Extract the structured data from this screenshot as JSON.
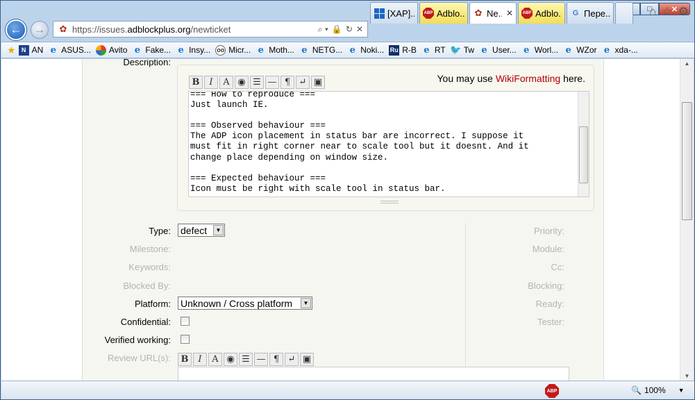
{
  "window": {
    "minimize": "–",
    "maximize": "□",
    "close": "✕"
  },
  "nav": {
    "url_prefix": "https://issues.",
    "url_domain": "adblockplus.org",
    "url_path": "/newticket",
    "address_icons": [
      "⌕ ▾",
      "🔒",
      "↻",
      "✕"
    ]
  },
  "tabs": [
    {
      "label": "[XAP]...",
      "icon": "windows-icon",
      "close": ""
    },
    {
      "label": "Adblo...",
      "icon": "adblock-icon",
      "close": ""
    },
    {
      "label": "Ne...",
      "icon": "paw-icon",
      "close": "✕",
      "active": true
    },
    {
      "label": "Adblo...",
      "icon": "adblock-icon",
      "close": ""
    },
    {
      "label": "Пере...",
      "icon": "translate-icon",
      "close": ""
    }
  ],
  "toolbar_right": {
    "home": "⌂",
    "favorites": "☆",
    "tools": "⚙"
  },
  "favorites": [
    {
      "label": "AN",
      "icon": "N"
    },
    {
      "label": "ASUS...",
      "icon": "e"
    },
    {
      "label": "Avito",
      "icon": ""
    },
    {
      "label": "Fake...",
      "icon": "e"
    },
    {
      "label": "Insy...",
      "icon": "e"
    },
    {
      "label": "Micr...",
      "icon": "oo"
    },
    {
      "label": "Moth...",
      "icon": "e"
    },
    {
      "label": "NETG...",
      "icon": "e"
    },
    {
      "label": "Noki...",
      "icon": "e"
    },
    {
      "label": "R-B",
      "icon": "Ru"
    },
    {
      "label": "RT",
      "icon": "e"
    },
    {
      "label": "Tw",
      "icon": "🐦"
    },
    {
      "label": "User...",
      "icon": "e"
    },
    {
      "label": "Worl...",
      "icon": "e"
    },
    {
      "label": "WZor",
      "icon": "e"
    },
    {
      "label": "xda-...",
      "icon": "e"
    }
  ],
  "form": {
    "description_label": "Description:",
    "wiki_toolbar": [
      "B",
      "I",
      "A",
      "◉",
      "☰",
      "—",
      "¶",
      "↵",
      "▣"
    ],
    "wiki_note_prefix": "You may use ",
    "wiki_note_link": "WikiFormatting",
    "wiki_note_suffix": " here.",
    "description_text": "=== How to reproduce ===\nJust launch IE.\n\n=== Observed behaviour ===\nThe ADP icon placement in status bar are incorrect. I suppose it\nmust fit in right corner near to scale tool but it doesnt. And it\nchange place depending on window size.\n\n=== Expected behaviour ===\nIcon must be right with scale tool in status bar.",
    "type_label": "Type:",
    "type_value": "defect",
    "milestone_label": "Milestone:",
    "keywords_label": "Keywords:",
    "blocked_by_label": "Blocked By:",
    "platform_label": "Platform:",
    "platform_value": "Unknown / Cross platform",
    "confidential_label": "Confidential:",
    "verified_label": "Verified working:",
    "review_label": "Review URL(s):",
    "priority_label": "Priority:",
    "module_label": "Module:",
    "cc_label": "Cc:",
    "blocking_label": "Blocking:",
    "ready_label": "Ready:",
    "tester_label": "Tester:"
  },
  "status": {
    "abp": "ABP",
    "zoom": "100%",
    "zoom_arrow": "▼"
  }
}
